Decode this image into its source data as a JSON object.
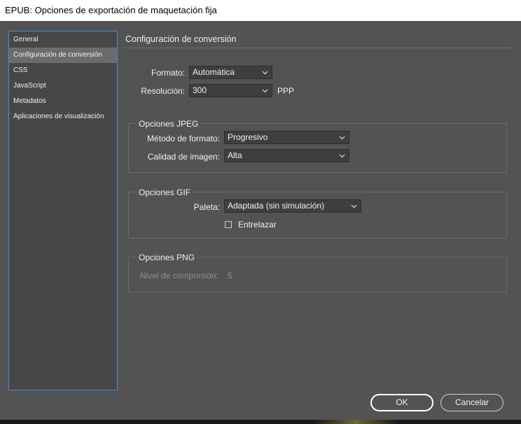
{
  "window": {
    "title": "EPUB: Opciones de exportación de maquetación fija"
  },
  "sidebar": {
    "items": [
      {
        "label": "General"
      },
      {
        "label": "Configuración de conversión",
        "selected": true
      },
      {
        "label": "CSS"
      },
      {
        "label": "JavaScript"
      },
      {
        "label": "Metadatos"
      },
      {
        "label": "Aplicaciones de visualización"
      }
    ]
  },
  "main": {
    "title": "Configuración de conversión",
    "formato": {
      "label": "Formato:",
      "value": "Automática"
    },
    "resolucion": {
      "label": "Resolución:",
      "value": "300",
      "unit": "PPP"
    },
    "jpeg": {
      "title": "Opciones JPEG",
      "metodo": {
        "label": "Método de formato:",
        "value": "Progresivo"
      },
      "calidad": {
        "label": "Calidad de imagen:",
        "value": "Alta"
      }
    },
    "gif": {
      "title": "Opciones GIF",
      "paleta": {
        "label": "Paleta:",
        "value": "Adaptada (sin simulación)"
      },
      "entrelazar": {
        "label": "Entrelazar",
        "checked": false
      }
    },
    "png": {
      "title": "Opciones PNG",
      "nivel": {
        "label": "Nivel de compresión:",
        "value": "5",
        "disabled": true
      }
    }
  },
  "footer": {
    "ok_label": "OK",
    "cancel_label": "Cancelar"
  },
  "icons": {
    "dropdown": "chevron-down-icon",
    "checkbox": "checkbox-icon"
  },
  "colors": {
    "background": "#535353",
    "sidebar_border": "#3f8fd8",
    "selected_item": "#6b6b6b",
    "field_bg": "#3e3e3e"
  }
}
